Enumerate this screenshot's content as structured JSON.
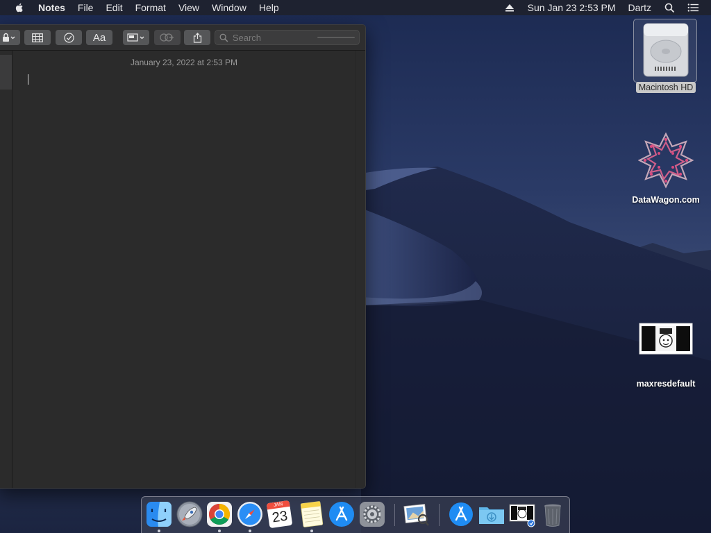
{
  "menubar": {
    "app_name": "Notes",
    "menus": [
      "File",
      "Edit",
      "Format",
      "View",
      "Window",
      "Help"
    ],
    "clock": "Sun Jan 23  2:53 PM",
    "user": "Dartz"
  },
  "notes": {
    "search_placeholder": "Search",
    "note_date": "January 23, 2022 at 2:53 PM",
    "format_button_label": "Aa"
  },
  "desktop": {
    "icons": [
      {
        "label": "Macintosh HD"
      },
      {
        "label": "DataWagon.com"
      },
      {
        "label": "maxresdefault"
      }
    ]
  },
  "dock": {
    "calendar_month": "JAN",
    "calendar_day": "23"
  }
}
